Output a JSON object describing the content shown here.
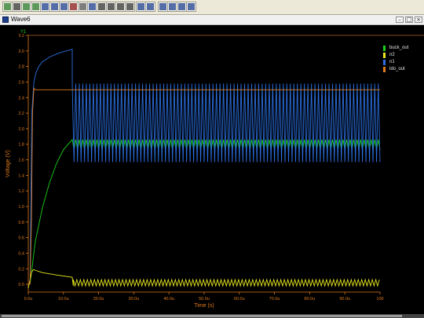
{
  "window": {
    "title": "Wave6"
  },
  "toolbar": {
    "icons": [
      "graph-icon",
      "arrow-icon",
      "step-up-icon",
      "step-down-icon",
      "marker-icon",
      "marker-icon",
      "marker-down-icon",
      "cut-icon",
      "grid-icon",
      "box-icon",
      "zoom-in-icon",
      "zoom-in-alt-icon",
      "zoom-out-icon",
      "zoom-fit-icon",
      "screen-icon",
      "chart-icon",
      "table-icon",
      "stack-icon",
      "layout-icon",
      "tile-icon"
    ]
  },
  "legend": [
    {
      "label": "buck_out",
      "color": "#19d219"
    },
    {
      "label": "n2",
      "color": "#e8e820"
    },
    {
      "label": "n1",
      "color": "#2b6fe0"
    },
    {
      "label": "ldo_out",
      "color": "#e07b1c"
    }
  ],
  "chart_data": {
    "type": "line",
    "title": "",
    "xlabel": "Time (s)",
    "ylabel": "Voltage (V)",
    "y_axis_label_text": "Y1",
    "xlim": [
      0,
      100
    ],
    "ylim": [
      -0.1,
      3.2
    ],
    "x_unit": "us",
    "x_ticks": [
      "0.0u",
      "10.0u",
      "20.0u",
      "30.0u",
      "40.0u",
      "50.0u",
      "60.0u",
      "70.0u",
      "80.0u",
      "90.0u",
      "100"
    ],
    "x_tick_values": [
      0,
      10,
      20,
      30,
      40,
      50,
      60,
      70,
      80,
      90,
      100
    ],
    "y_ticks": [
      "0.0",
      "0.2",
      "0.4",
      "0.6",
      "0.8",
      "1.0",
      "1.2",
      "1.4",
      "1.6",
      "1.8",
      "2.0",
      "2.2",
      "2.4",
      "2.6",
      "2.8",
      "3.0",
      "3.2"
    ],
    "y_tick_values": [
      0,
      0.2,
      0.4,
      0.6,
      0.8,
      1.0,
      1.2,
      1.4,
      1.6,
      1.8,
      2.0,
      2.2,
      2.4,
      2.6,
      2.8,
      3.0,
      3.2
    ],
    "grid": false,
    "legend_position": "right",
    "series": [
      {
        "name": "buck_out",
        "color": "#19d219",
        "x": [
          0.5,
          2,
          4,
          6,
          8,
          10,
          12.5
        ],
        "y": [
          0.0,
          0.55,
          0.98,
          1.3,
          1.55,
          1.73,
          1.86
        ],
        "ripple": {
          "start": 12.5,
          "end": 100,
          "period": 1.0,
          "low": 1.73,
          "high": 1.86
        }
      },
      {
        "name": "n2",
        "color": "#e8e820",
        "x": [
          0,
          0.5,
          1.0,
          1.5,
          2.0,
          4,
          8,
          12.5,
          12.8
        ],
        "y": [
          -0.05,
          0.06,
          0.16,
          0.19,
          0.18,
          0.15,
          0.12,
          0.09,
          -0.02
        ],
        "ripple": {
          "start": 12.8,
          "end": 100,
          "period": 1.0,
          "low": -0.02,
          "high": 0.06
        }
      },
      {
        "name": "n1",
        "color": "#2b6fe0",
        "x": [
          0.5,
          1.0,
          1.6,
          2.2,
          3,
          4,
          6,
          8,
          10,
          12.5
        ],
        "y": [
          0.0,
          2.2,
          2.6,
          2.72,
          2.8,
          2.86,
          2.92,
          2.96,
          2.99,
          3.02
        ],
        "ripple": {
          "start": 12.5,
          "end": 100,
          "period": 1.0,
          "low": 1.57,
          "high": 2.58
        }
      },
      {
        "name": "ldo_out",
        "color": "#e07b1c",
        "x": [
          0.5,
          0.9,
          1.2,
          1.6,
          2.0,
          100
        ],
        "y": [
          0.0,
          0.78,
          2.2,
          2.52,
          2.5,
          2.5
        ],
        "ripple": null
      }
    ]
  }
}
